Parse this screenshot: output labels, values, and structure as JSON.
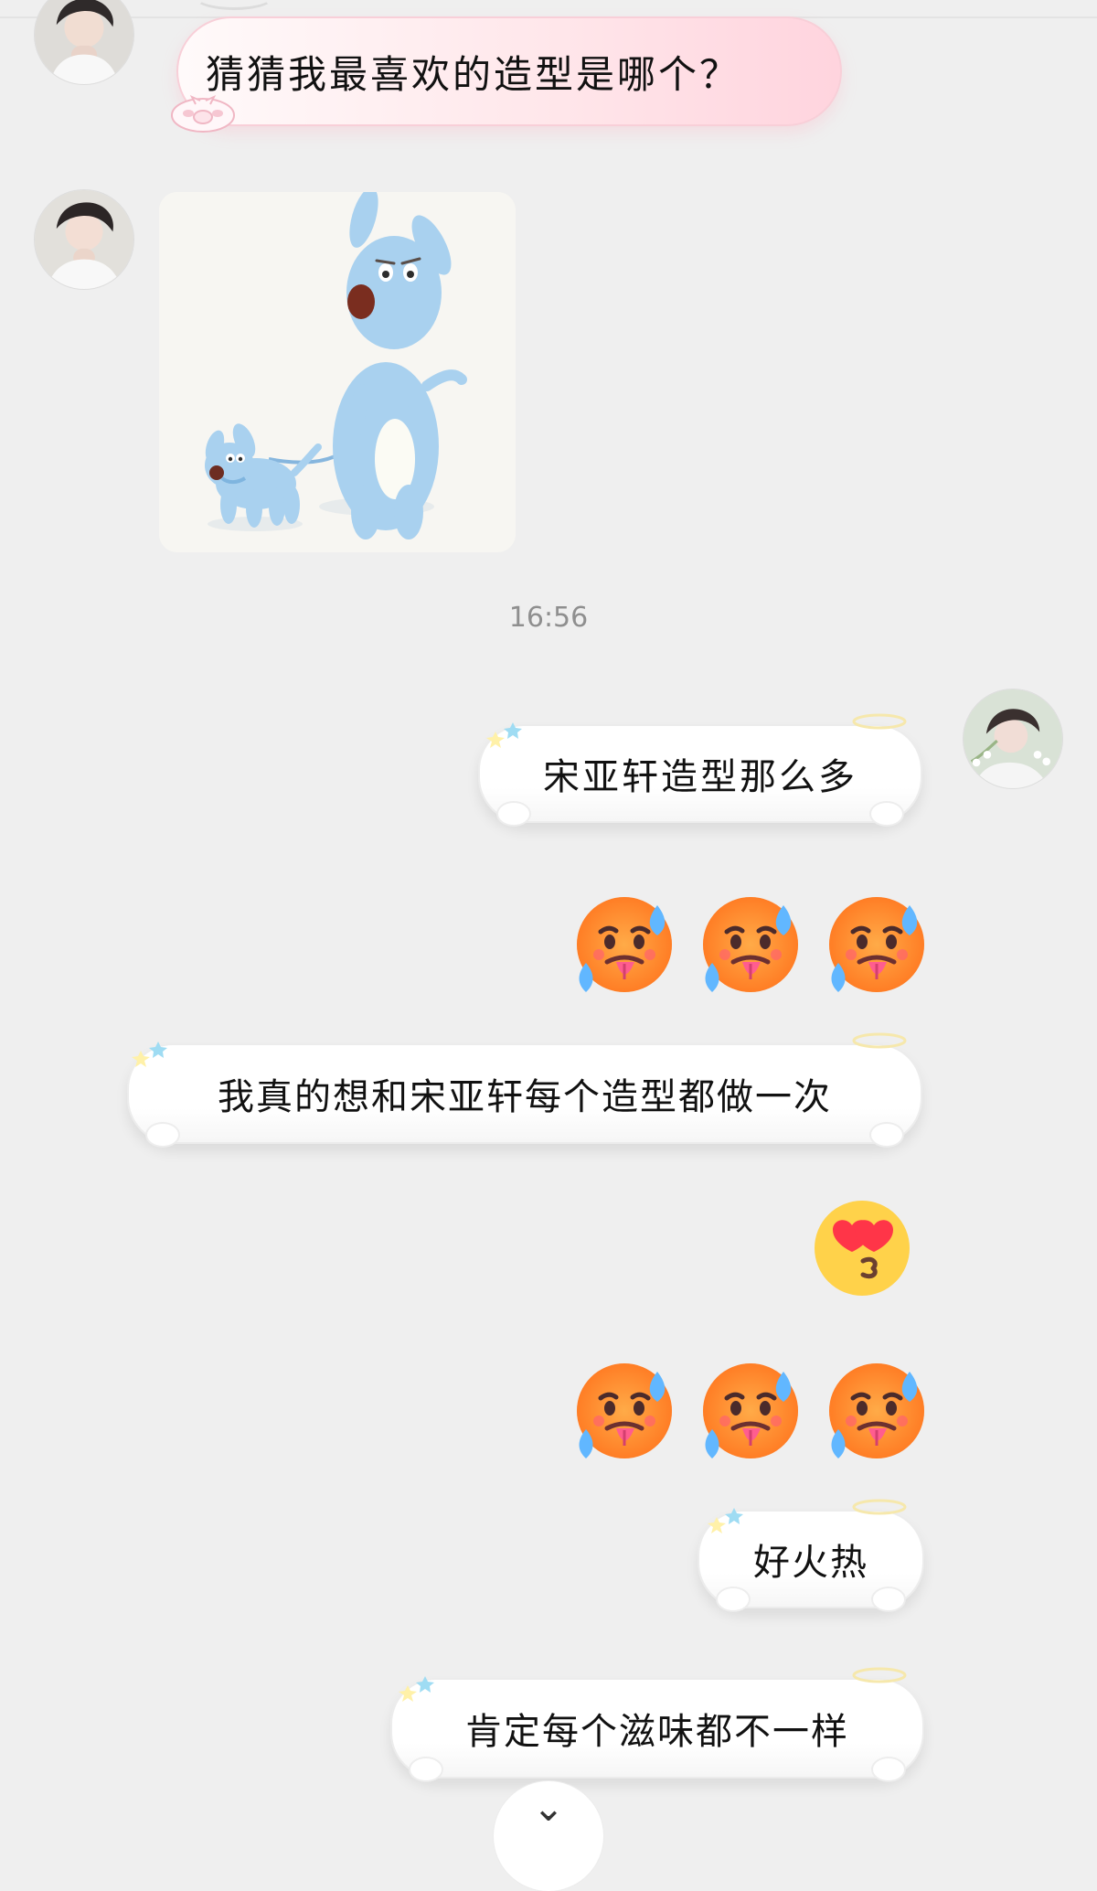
{
  "messages": {
    "received_text": "猜猜我最喜欢的造型是哪个？",
    "timestamp": "16:56",
    "sent_1": "宋亚轩造型那么多",
    "sent_2": "我真的想和宋亚轩每个造型都做一次",
    "sent_3": "好火热",
    "sent_4": "肯定每个滋味都不一样"
  },
  "icons": {
    "scroll_down": "chevron-down-icon",
    "sticker_image": "blue-dog-image"
  }
}
